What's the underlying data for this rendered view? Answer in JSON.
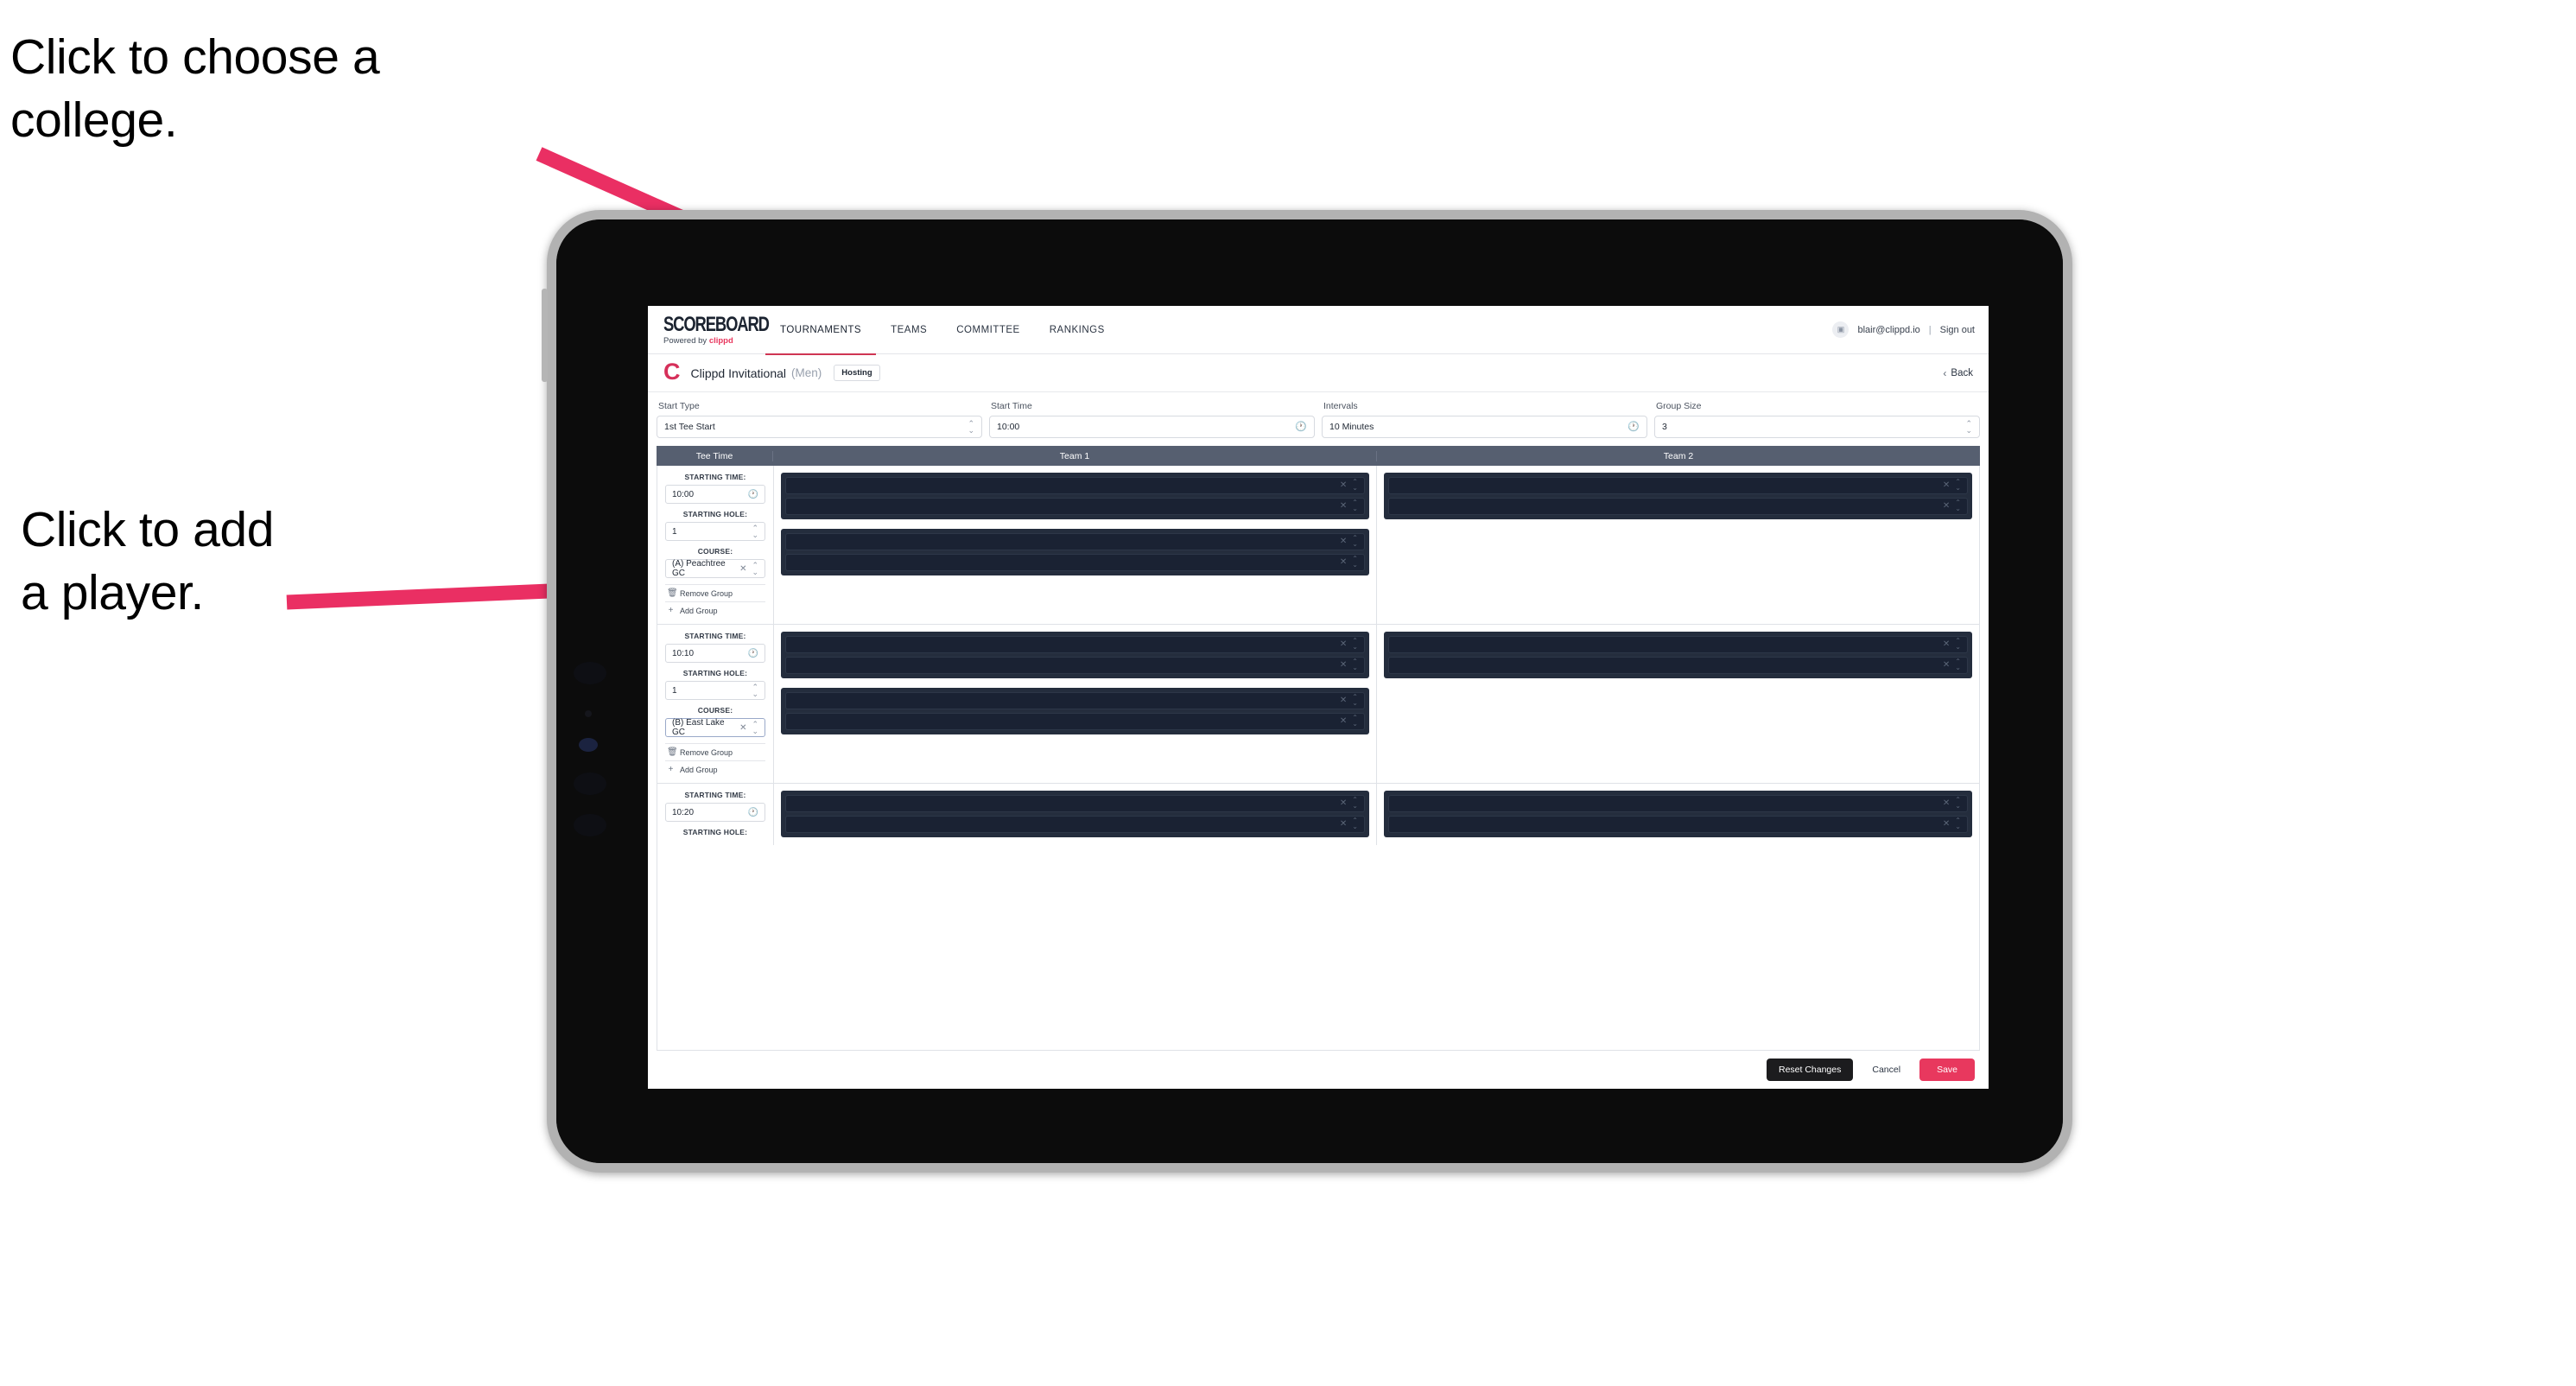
{
  "annotations": {
    "choose_college": "Click to choose a\ncollege.",
    "add_player": "Click to add\na player."
  },
  "colors": {
    "accent_pink": "#e8385e",
    "brand_red": "#cf3553",
    "table_header": "#565f70",
    "panel_dark": "#242d3d",
    "slot_dark": "#1a2233"
  },
  "topnav": {
    "logo_main": "SCOREBOARD",
    "logo_sub_prefix": "Powered by ",
    "logo_sub_brand": "clippd",
    "tabs": [
      {
        "label": "TOURNAMENTS",
        "active": true
      },
      {
        "label": "TEAMS",
        "active": false
      },
      {
        "label": "COMMITTEE",
        "active": false
      },
      {
        "label": "RANKINGS",
        "active": false
      }
    ],
    "user_email": "blair@clippd.io",
    "separator": "|",
    "sign_out": "Sign out",
    "avatar_glyph": "▣"
  },
  "subheader": {
    "logo_letter": "C",
    "tournament_name": "Clippd Invitational",
    "gender": "(Men)",
    "badge": "Hosting",
    "back_chevron": "‹",
    "back_label": "Back"
  },
  "controls": [
    {
      "label": "Start Type",
      "value": "1st Tee Start",
      "icon": "stepper-icon"
    },
    {
      "label": "Start Time",
      "value": "10:00",
      "icon": "clock-icon"
    },
    {
      "label": "Intervals",
      "value": "10 Minutes",
      "icon": "clock-icon"
    },
    {
      "label": "Group Size",
      "value": "3",
      "icon": "stepper-icon"
    }
  ],
  "table": {
    "headers": [
      "Tee Time",
      "Team 1",
      "Team 2"
    ],
    "labels": {
      "starting_time": "STARTING TIME:",
      "starting_hole": "STARTING HOLE:",
      "course": "COURSE:",
      "remove_group": "Remove Group",
      "add_group": "Add Group",
      "trash_glyph": "🗑",
      "plus_glyph": "+",
      "clock_glyph": "🕐",
      "clear_glyph": "✕"
    },
    "rows": [
      {
        "starting_time": "10:00",
        "starting_hole": "1",
        "course": "(A) Peachtree GC",
        "course_focused": false,
        "team1_groups": [
          {
            "slots": [
              {
                "name": ""
              },
              {
                "name": ""
              }
            ]
          },
          {
            "slots": [
              {
                "name": ""
              },
              {
                "name": ""
              }
            ]
          }
        ],
        "team2_groups": [
          {
            "slots": [
              {
                "name": ""
              },
              {
                "name": ""
              }
            ]
          }
        ]
      },
      {
        "starting_time": "10:10",
        "starting_hole": "1",
        "course": "(B) East Lake GC",
        "course_focused": true,
        "team1_groups": [
          {
            "slots": [
              {
                "name": ""
              },
              {
                "name": ""
              }
            ]
          },
          {
            "slots": [
              {
                "name": ""
              },
              {
                "name": ""
              }
            ]
          }
        ],
        "team2_groups": [
          {
            "slots": [
              {
                "name": ""
              },
              {
                "name": ""
              }
            ]
          }
        ]
      },
      {
        "starting_time": "10:20",
        "starting_hole": "",
        "course": "",
        "course_focused": false,
        "partial": true,
        "team1_groups": [
          {
            "slots": [
              {
                "name": ""
              },
              {
                "name": ""
              }
            ]
          }
        ],
        "team2_groups": [
          {
            "slots": [
              {
                "name": ""
              },
              {
                "name": ""
              }
            ]
          }
        ]
      }
    ]
  },
  "footer": {
    "reset": "Reset Changes",
    "cancel": "Cancel",
    "save": "Save"
  }
}
